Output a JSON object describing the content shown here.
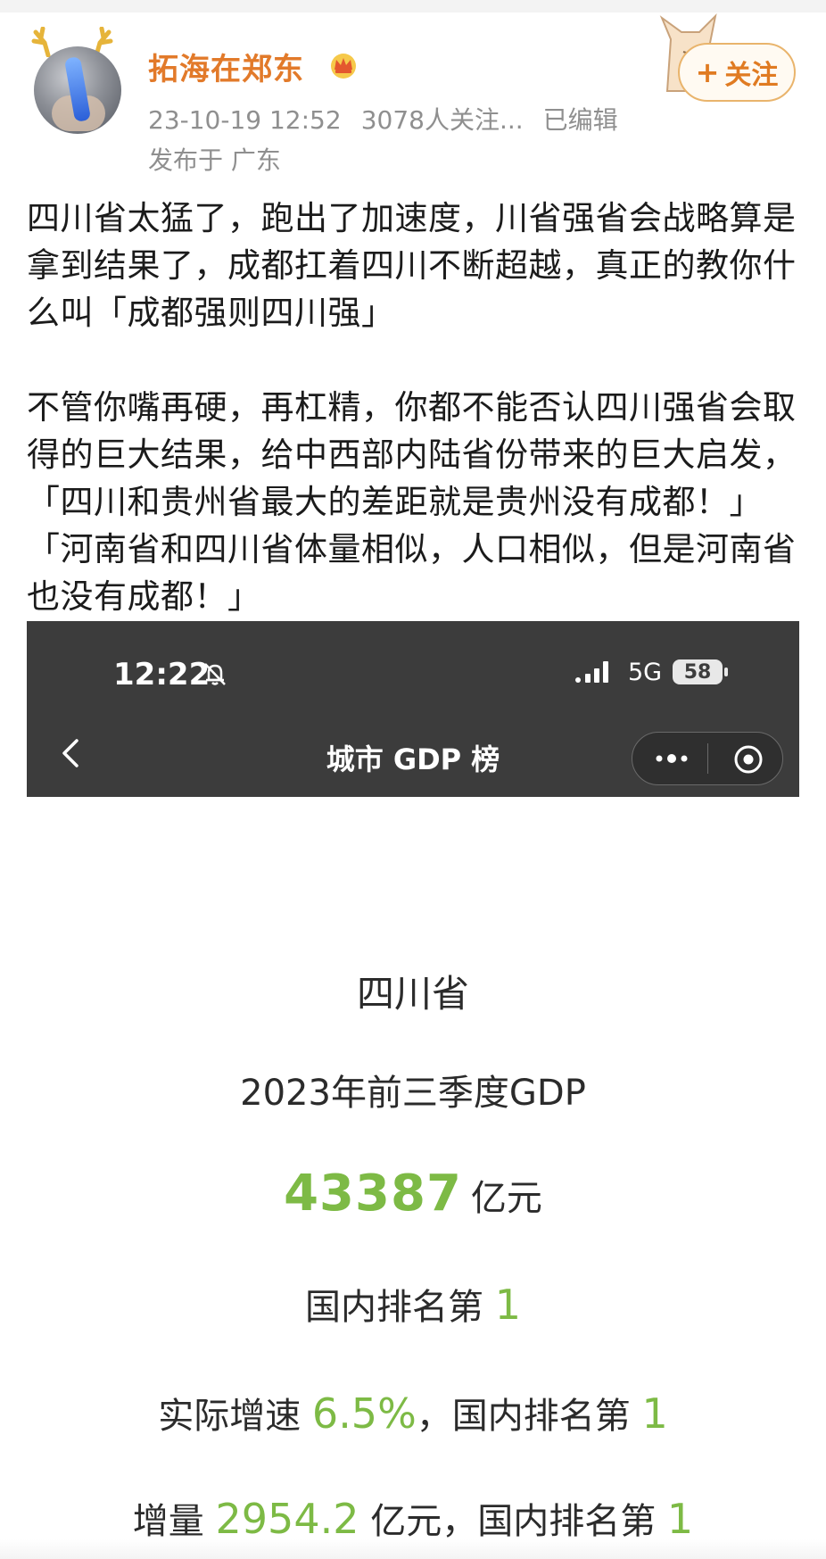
{
  "header": {
    "user_name": "拓海在郑东",
    "timestamp": "23-10-19 12:52",
    "followers": "3078人关注...",
    "edited": "已编辑",
    "location": "发布于 广东",
    "follow_label": "关注",
    "follow_plus": "+"
  },
  "post": {
    "paragraph1": "四川省太猛了，跑出了加速度，川省强省会战略算是拿到结果了，成都扛着四川不断超越，真正的教你什么叫「成都强则四川强」",
    "paragraph2": "不管你嘴再硬，再杠精，你都不能否认四川强省会取得的巨大结果，给中西部内陆省份带来的巨大启发，「四川和贵州省最大的差距就是贵州没有成都！」「河南省和四川省体量相似，人口相似，但是河南省也没有成都！」"
  },
  "screenshot": {
    "status": {
      "time": "12:22",
      "network": "5G",
      "battery": "58"
    },
    "nav_title": "城市 GDP 榜",
    "province": "四川省",
    "period": "2023年前三季度GDP",
    "gdp_value": "43387",
    "gdp_unit": "亿元",
    "rank_label": "国内排名第",
    "rank_value": "1",
    "growth_label": "实际增速",
    "growth_value": "6.5%",
    "growth_rank_label": "，国内排名第",
    "growth_rank_value": "1",
    "increment_label": "增量",
    "increment_value": "2954.2",
    "increment_unit": "亿元",
    "increment_rank_label": "，国内排名第",
    "increment_rank_value": "1"
  },
  "colors": {
    "username": "#e27a2a",
    "accent_green": "#7dba45",
    "dark_bar": "#3c3c3c"
  }
}
